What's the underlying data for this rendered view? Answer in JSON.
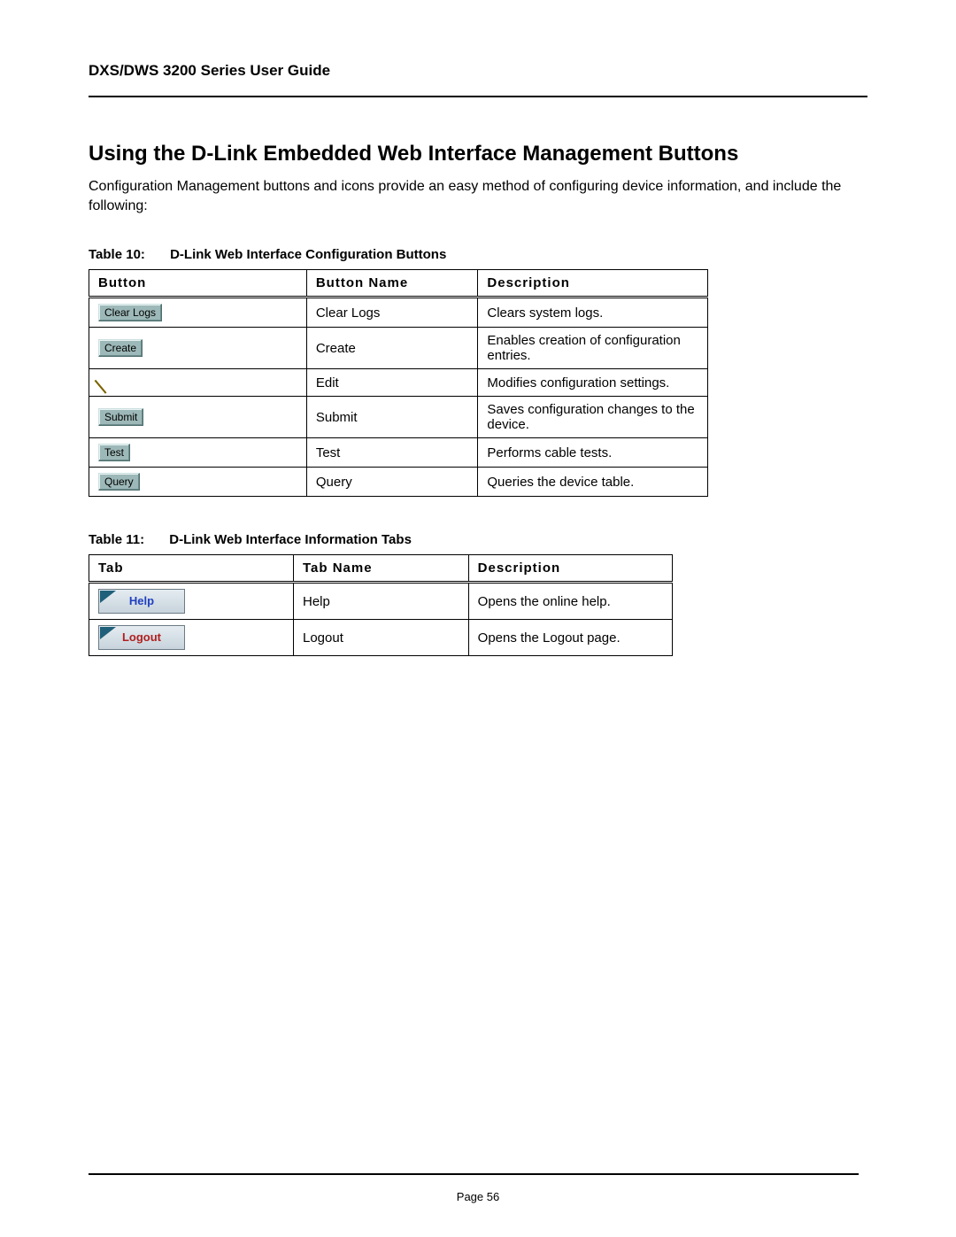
{
  "doc_title": "DXS/DWS 3200 Series User Guide",
  "section_heading": "Using the D-Link Embedded Web Interface Management Buttons",
  "intro_text": "Configuration Management buttons and icons provide an easy method of configuring device information, and include the following:",
  "table10": {
    "caption_num": "Table 10:",
    "caption_title": "D-Link Web Interface Configuration Buttons",
    "headers": {
      "c1": "Button",
      "c2": "Button Name",
      "c3": "Description"
    },
    "rows": [
      {
        "btn_label": "Clear Logs",
        "name": "Clear Logs",
        "desc": "Clears system logs.",
        "kind": "grey"
      },
      {
        "btn_label": "Create",
        "name": "Create",
        "desc": "Enables creation of configuration entries.",
        "kind": "grey"
      },
      {
        "btn_label": "",
        "name": "Edit",
        "desc": "Modifies configuration settings.",
        "kind": "pencil"
      },
      {
        "btn_label": "Submit",
        "name": "Submit",
        "desc": "Saves configuration changes to the device.",
        "kind": "grey"
      },
      {
        "btn_label": "Test",
        "name": "Test",
        "desc": "Performs cable tests.",
        "kind": "grey"
      },
      {
        "btn_label": "Query",
        "name": "Query",
        "desc": "Queries the device table.",
        "kind": "grey"
      }
    ]
  },
  "table11": {
    "caption_num": "Table 11:",
    "caption_title": "D-Link Web Interface Information Tabs",
    "headers": {
      "c1": "Tab",
      "c2": "Tab Name",
      "c3": "Description"
    },
    "rows": [
      {
        "btn_label": "Help",
        "name": "Help",
        "desc": "Opens the online help.",
        "kind": "help"
      },
      {
        "btn_label": "Logout",
        "name": "Logout",
        "desc": "Opens the Logout page.",
        "kind": "logout"
      }
    ]
  },
  "page_number": "Page 56"
}
